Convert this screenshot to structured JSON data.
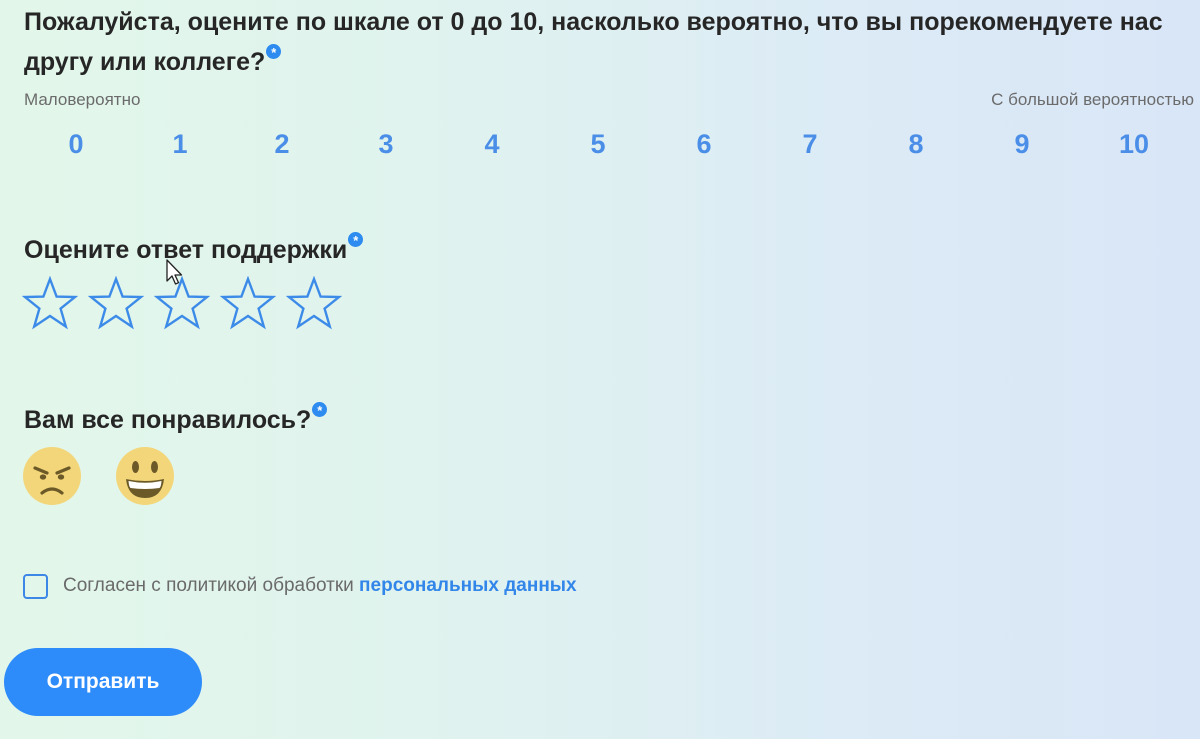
{
  "nps": {
    "question": "Пожалуйста, оцените по шкале от 0 до 10, насколько вероятно, что вы порекомендуете нас другу или коллеге?",
    "required_mark": "*",
    "low_label": "Маловероятно",
    "high_label": "С большой вероятностью",
    "options": [
      "0",
      "1",
      "2",
      "3",
      "4",
      "5",
      "6",
      "7",
      "8",
      "9",
      "10"
    ]
  },
  "support_rating": {
    "question": "Оцените ответ поддержки",
    "required_mark": "*",
    "stars_total": 5,
    "stars_selected": 0
  },
  "satisfaction": {
    "question": "Вам все понравилось?",
    "required_mark": "*",
    "options": [
      "angry-face",
      "grinning-face"
    ]
  },
  "consent": {
    "text": "Согласен с политикой обработки",
    "link_text": "персональных данных",
    "checked": false
  },
  "submit": {
    "label": "Отправить"
  },
  "colors": {
    "accent": "#2e8bfa",
    "scale_number": "#4a8ee8",
    "emoji_face": "#f3d67a"
  }
}
